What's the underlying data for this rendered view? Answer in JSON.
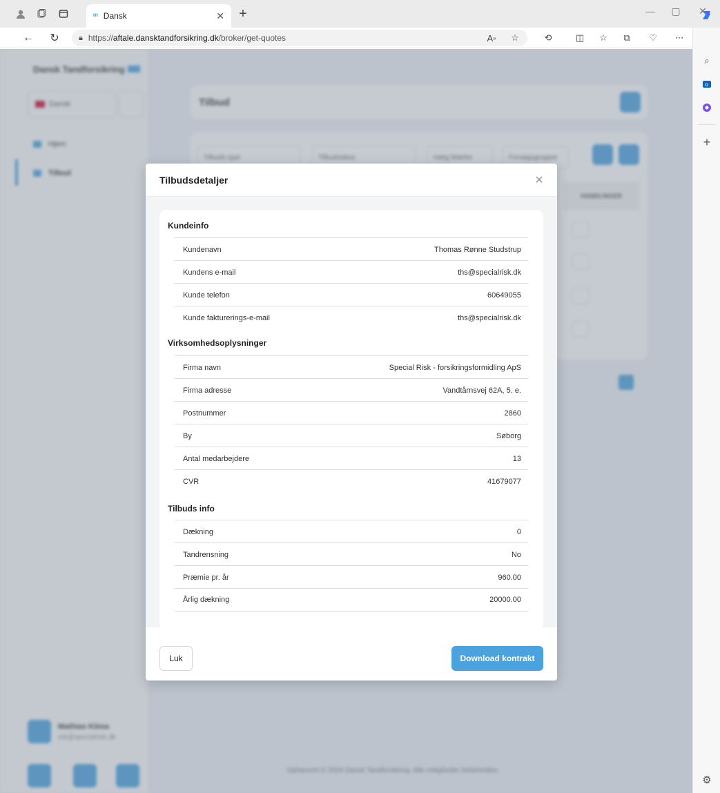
{
  "browser": {
    "tab_title": "Dansk",
    "url_prefix": "https://",
    "url_host": "aftale.dansktandforsikring.dk",
    "url_path": "/broker/get-quotes"
  },
  "background": {
    "logo": "Dansk Tandforsikring",
    "language": "Dansk",
    "nav": [
      {
        "label": "Hjem"
      },
      {
        "label": "Tilbud"
      }
    ],
    "page_title": "Tilbud",
    "filters": [
      "Tilbuds type",
      "Tilbudstatus",
      "Vælg Mærke",
      "Forsøgsgrupper"
    ],
    "table_header": "HANDLINGER",
    "user_name": "Mathias Kiima",
    "user_email": "mk@specialrisk.dk",
    "footer": "Ophavsret © 2024 Dansk Tandforsikring. Alle rettigheder forbeholdes."
  },
  "modal": {
    "title": "Tilbudsdetaljer",
    "sections": [
      {
        "title": "Kundeinfo",
        "rows": [
          {
            "label": "Kundenavn",
            "value": "Thomas Rønne Studstrup"
          },
          {
            "label": "Kundens e-mail",
            "value": "ths@specialrisk.dk"
          },
          {
            "label": "Kunde telefon",
            "value": "60649055"
          },
          {
            "label": "Kunde fakturerings-e-mail",
            "value": "ths@specialrisk.dk"
          }
        ]
      },
      {
        "title": "Virksomhedsoplysninger",
        "rows": [
          {
            "label": "Firma navn",
            "value": "Special Risk - forsikringsformidling ApS"
          },
          {
            "label": "Firma adresse",
            "value": "Vandtårnsvej 62A, 5. e."
          },
          {
            "label": "Postnummer",
            "value": "2860"
          },
          {
            "label": "By",
            "value": "Søborg"
          },
          {
            "label": "Antal medarbejdere",
            "value": "13"
          },
          {
            "label": "CVR",
            "value": "41679077"
          }
        ]
      },
      {
        "title": "Tilbuds info",
        "rows": [
          {
            "label": "Dækning",
            "value": "0"
          },
          {
            "label": "Tandrensning",
            "value": "No"
          },
          {
            "label": "Præmie pr. år",
            "value": "960.00"
          },
          {
            "label": "Årlig dækning",
            "value": "20000.00"
          }
        ]
      }
    ],
    "close_label": "Luk",
    "download_label": "Download kontrakt"
  },
  "colors": {
    "accent": "#4aa3df",
    "overlay": "#788494"
  }
}
